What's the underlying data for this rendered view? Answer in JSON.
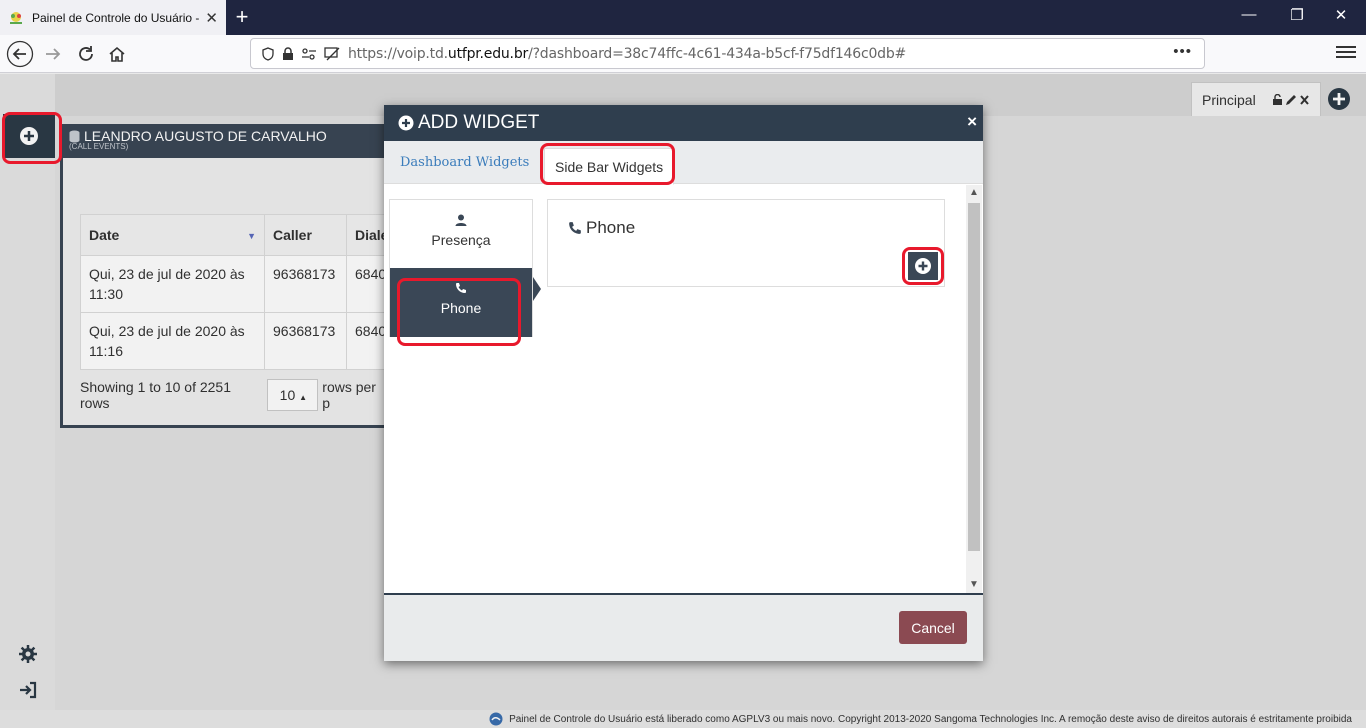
{
  "browser": {
    "tab_title": "Painel de Controle do Usuário -",
    "url_prefix": "https://voip.td.",
    "url_domain": "utfpr.edu.br",
    "url_suffix": "/?dashboard=38c74ffc-4c61-434a-b5cf-f75df146c0db#",
    "url_more": "•••"
  },
  "app": {
    "top_tab": "Principal",
    "widget": {
      "title": "LEANDRO AUGUSTO DE CARVALHO",
      "subtitle": "(CALL EVENTS)",
      "columns": [
        "Date",
        "Caller",
        "Diale"
      ],
      "rows": [
        {
          "date": "Qui, 23 de jul de 2020 às 11:30",
          "caller": "96368173",
          "dialed": "6840"
        },
        {
          "date": "Qui, 23 de jul de 2020 às 11:16",
          "caller": "96368173",
          "dialed": "6840"
        }
      ],
      "pager_text": "Showing 1 to 10 of 2251 rows",
      "page_size": "10",
      "page_size_suffix": "rows per p"
    },
    "footer": "Painel de Controle do Usuário está liberado como AGPLV3 ou mais novo. Copyright 2013-2020 Sangoma Technologies Inc. A remoção deste aviso de direitos autorais é estritamente proibida"
  },
  "modal": {
    "title": "ADD WIDGET",
    "close": "×",
    "tabs": {
      "dashboard": "Dashboard Widgets",
      "sidebar": "Side Bar Widgets"
    },
    "list": [
      {
        "label": "Presença",
        "icon": "user-icon"
      },
      {
        "label": "Phone",
        "icon": "phone-icon"
      }
    ],
    "card_title": "Phone",
    "cancel": "Cancel"
  },
  "colors": {
    "accent_dark": "#2f3e4e",
    "highlight": "#e8192c",
    "cancel": "#8b4a52",
    "link": "#3a7cbb"
  }
}
